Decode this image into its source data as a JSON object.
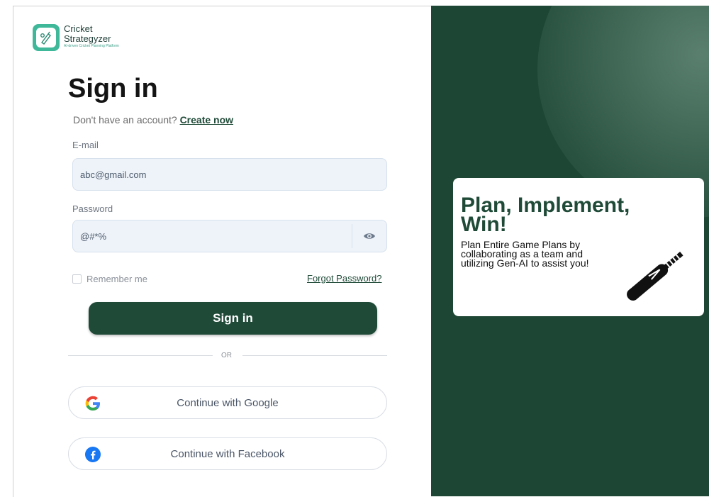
{
  "brand": {
    "line1": "Cricket",
    "line2": "Strategyzer",
    "tagline": "AI-driven Cricket Planning Platform"
  },
  "signin": {
    "title": "Sign in",
    "no_account_text": "Don't have an account?",
    "create_link": "Create now",
    "email_label": "E-mail",
    "email_value": "abc@gmail.com",
    "password_label": "Password",
    "password_value": "@#*%",
    "remember_label": "Remember me",
    "forgot_link": "Forgot Password?",
    "submit_label": "Sign in",
    "or_text": "OR",
    "google_label": "Continue with Google",
    "facebook_label": "Continue with Facebook"
  },
  "promo": {
    "headline": "Plan, Implement, Win!",
    "body": "Plan Entire Game Plans by collaborating as a team and utilizing Gen-AI to assist you!"
  },
  "icons": {
    "logo": "cricket-bat-logo-icon",
    "eye": "eye-icon",
    "google": "google-icon",
    "facebook": "facebook-icon",
    "bat": "cricket-bat-icon"
  },
  "colors": {
    "brand_green": "#1f4a38",
    "panel_green": "#1e4634",
    "logo_teal": "#3fb89a"
  }
}
